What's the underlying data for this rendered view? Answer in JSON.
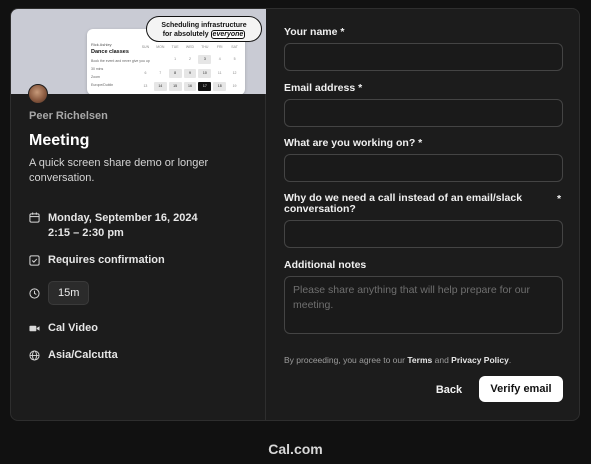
{
  "banner": {
    "tagline_line1": "Scheduling infrastructure",
    "tagline_line2_prefix": "for absolutely",
    "tagline_highlight": "everyone",
    "mock_host": "Rick Ashley",
    "mock_title": "Dance classes",
    "mock_rows": [
      "Book the event and never give you up",
      "30 mins",
      "Zoom",
      "Europe/Dublin"
    ],
    "mock_weekdays": [
      "SUN",
      "MON",
      "TUE",
      "WED",
      "THU",
      "FRI",
      "SAT"
    ],
    "mock_days": [
      "",
      "",
      "1",
      "2",
      "3",
      "4",
      "5",
      "6",
      "7",
      "8",
      "9",
      "10",
      "11",
      "12",
      "13",
      "14",
      "15",
      "16",
      "17",
      "18",
      "19"
    ]
  },
  "host_name": "Peer Richelsen",
  "event": {
    "title": "Meeting",
    "description": "A quick screen share demo or longer conversation.",
    "date": "Monday, September 16, 2024",
    "time": "2:15 – 2:30 pm",
    "confirmation": "Requires confirmation",
    "duration": "15m",
    "location": "Cal Video",
    "timezone": "Asia/Calcutta"
  },
  "form": {
    "name_label": "Your name *",
    "email_label": "Email address *",
    "working_label": "What are you working on? *",
    "why_label": "Why do we need a call instead of an email/slack conversation?",
    "why_required": "*",
    "notes_label": "Additional notes",
    "notes_placeholder": "Please share anything that will help prepare for our meeting.",
    "name_value": "",
    "email_value": "",
    "working_value": "",
    "why_value": ""
  },
  "terms": {
    "prefix": "By proceeding, you agree to our",
    "terms_link": "Terms",
    "and": "and",
    "privacy_link": "Privacy Policy",
    "suffix": "."
  },
  "actions": {
    "back_label": "Back",
    "verify_label": "Verify email"
  },
  "footer": {
    "brand": "Cal.com"
  }
}
